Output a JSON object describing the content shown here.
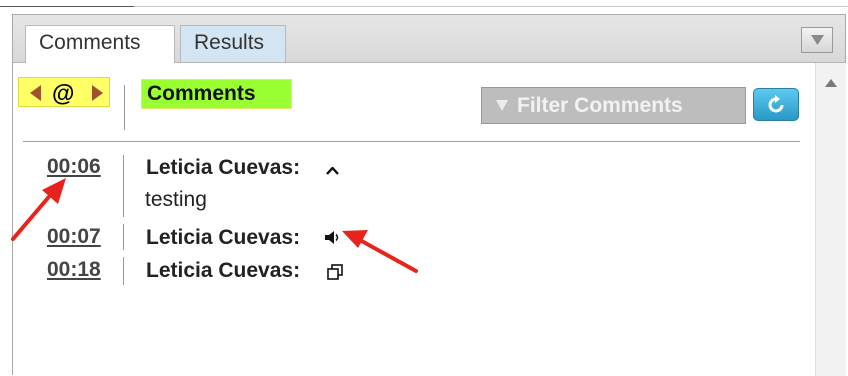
{
  "tabs": [
    {
      "label": "Comments"
    },
    {
      "label": "Results"
    }
  ],
  "toolbar": {
    "nav_symbol": "@",
    "section_label": "Comments",
    "filter_label": "Filter Comments"
  },
  "comments": [
    {
      "time": "00:06",
      "author": "Leticia Cuevas:",
      "indicator": "chevron-up-icon",
      "text": "testing"
    },
    {
      "time": "00:07",
      "author": "Leticia Cuevas:",
      "indicator": "speaker-icon"
    },
    {
      "time": "00:18",
      "author": "Leticia Cuevas:",
      "indicator": "copy-icon"
    }
  ],
  "colors": {
    "nav_highlight": "#ffff66",
    "section_highlight": "#99ff33",
    "refresh_button": "#3aa9d6",
    "annotation_arrow": "#e8231c"
  }
}
